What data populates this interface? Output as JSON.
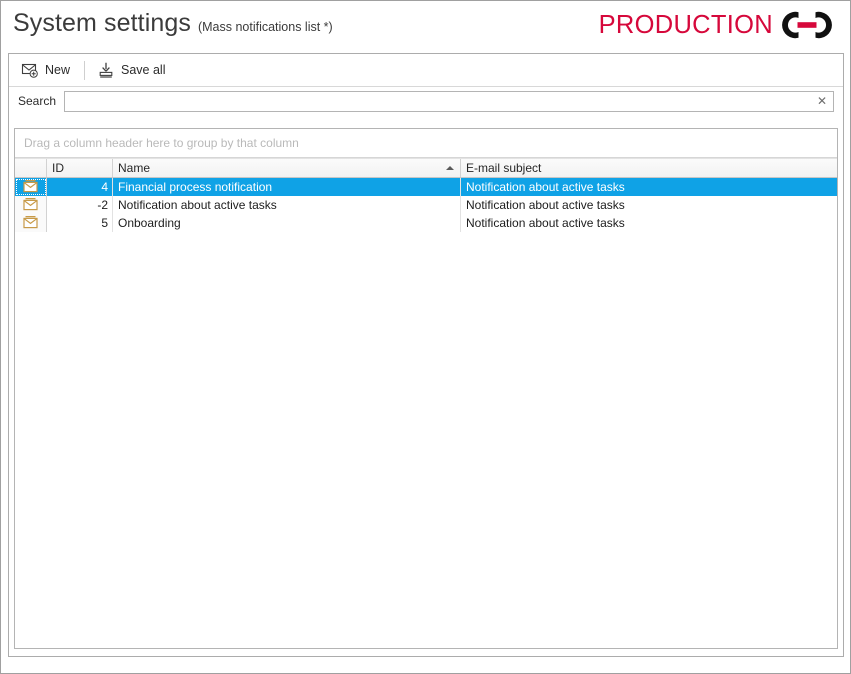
{
  "window": {
    "title": "System settings",
    "subtitle": "(Mass notifications list *)"
  },
  "brand": {
    "text": "PRODUCTION",
    "mark_icon": "chain-link-icon",
    "text_color": "#d6083b",
    "mark_color": "#111111",
    "mark_accent_color": "#d6083b"
  },
  "toolbar": {
    "new_label": "New",
    "new_icon": "new-mail-icon",
    "save_all_label": "Save all",
    "save_all_icon": "save-icon"
  },
  "search": {
    "label": "Search",
    "value": "",
    "placeholder": "",
    "clear_icon": "close-icon",
    "clear_glyph": "✕"
  },
  "grid": {
    "group_panel_hint": "Drag a column header here to group by that column",
    "columns": [
      {
        "key": "indicator",
        "label": "",
        "sorted": ""
      },
      {
        "key": "id",
        "label": "ID",
        "sorted": ""
      },
      {
        "key": "name",
        "label": "Name",
        "sorted": "ascending"
      },
      {
        "key": "subject",
        "label": "E-mail subject",
        "sorted": ""
      }
    ],
    "rows": [
      {
        "icon": "mass-mail-icon",
        "id": "4",
        "name": "Financial process notification",
        "subject": "Notification about active tasks",
        "selected": true
      },
      {
        "icon": "mass-mail-icon",
        "id": "-2",
        "name": "Notification about active tasks",
        "subject": "Notification about active tasks",
        "selected": false
      },
      {
        "icon": "mass-mail-icon",
        "id": "5",
        "name": "Onboarding",
        "subject": "Notification about active tasks",
        "selected": false
      }
    ],
    "selection_color": "#0fa2e6",
    "row_icon_color": "#d3a24a"
  }
}
